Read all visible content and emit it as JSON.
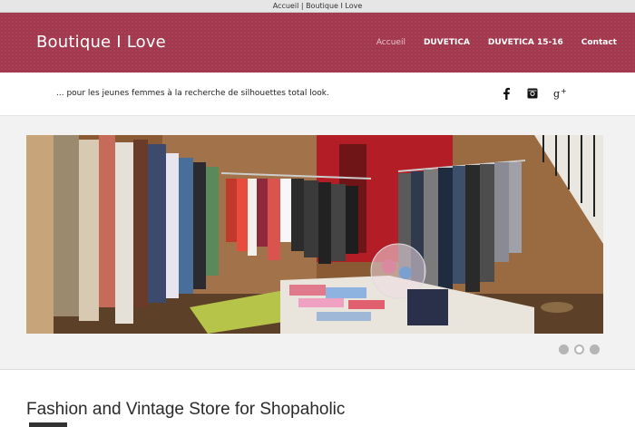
{
  "window": {
    "title": "Accueil | Boutique I Love"
  },
  "header": {
    "brand": "Boutique I Love",
    "nav": [
      {
        "label": "Accueil",
        "active": true
      },
      {
        "label": "DUVETICA",
        "active": false
      },
      {
        "label": "DUVETICA 15-16",
        "active": false
      },
      {
        "label": "Contact",
        "active": false
      }
    ]
  },
  "subbar": {
    "tagline": "... pour les jeunes femmes à la recherche de silhouettes total look.",
    "social": [
      {
        "icon": "facebook-icon",
        "glyph": "f"
      },
      {
        "icon": "instagram-icon",
        "glyph": ""
      },
      {
        "icon": "googleplus-icon",
        "glyph": "g+"
      }
    ]
  },
  "slider": {
    "image": "boutique-interior-photo",
    "dots": 3,
    "active_dot": 1
  },
  "content": {
    "title": "Fashion and Vintage Store for Shopaholic"
  },
  "colors": {
    "header": "#a3394f",
    "nav_active": "#e7c3cb"
  }
}
